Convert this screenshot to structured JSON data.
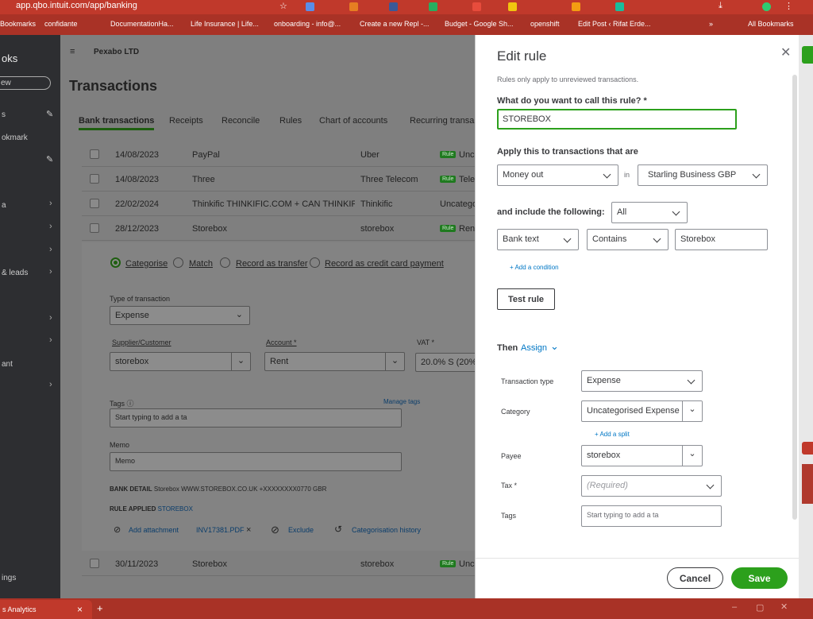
{
  "browser": {
    "url": "app.qbo.intuit.com/app/banking",
    "bookmarks": [
      "Bookmarks",
      "confidante",
      "DocumentationHa...",
      "Life Insurance | Life...",
      "onboarding - info@...",
      "Create a new Repl -...",
      "Budget - Google Sh...",
      "openshift",
      "Edit Post ‹ Rifat Erde..."
    ],
    "all_bookmarks": "All Bookmarks",
    "bottom_tab": "s Analytics"
  },
  "nav": {
    "items": [
      "oks",
      "ew",
      "s",
      "okmark",
      "a",
      "& leads",
      "ant",
      "ings"
    ]
  },
  "company": "Pexabo LTD",
  "page_title": "Transactions",
  "tabs": [
    "Bank transactions",
    "Receipts",
    "Reconcile",
    "Rules",
    "Chart of accounts",
    "Recurring transa"
  ],
  "rows": [
    {
      "date": "14/08/2023",
      "desc": "PayPal",
      "payee": "Uber",
      "cat": "Unca"
    },
    {
      "date": "14/08/2023",
      "desc": "Three",
      "payee": "Three Telecom",
      "cat": "Tele"
    },
    {
      "date": "22/02/2024",
      "desc": "Thinkific THINKIFIC.COM + CAN THINKIFIC.C",
      "payee": "Thinkific",
      "cat": "Uncategor"
    },
    {
      "date": "28/12/2023",
      "desc": "Storebox",
      "payee": "storebox",
      "cat": "Rent"
    }
  ],
  "last_row": {
    "date": "30/11/2023",
    "desc": "Storebox",
    "payee": "storebox",
    "cat": "Unca"
  },
  "rule_badge": "Rule",
  "expanded": {
    "radios": [
      "Categorise",
      "Match",
      "Record as transfer",
      "Record as credit card payment"
    ],
    "type_label": "Type of transaction",
    "type_value": "Expense",
    "supplier_label": "Supplier/Customer",
    "supplier_value": "storebox",
    "account_label": "Account *",
    "account_value": "Rent",
    "vat_label": "VAT *",
    "vat_value": "20.0% S (20%",
    "tags_label": "Tags ⓘ",
    "manage_tags": "Manage tags",
    "tags_placeholder": "Start typing to add a ta",
    "memo_label": "Memo",
    "memo_placeholder": "Memo",
    "bank_detail_label": "BANK DETAIL",
    "bank_detail_value": "Storebox WWW.STOREBOX.CO.UK +XXXXXXXX0770 GBR",
    "rule_applied_label": "RULE APPLIED",
    "rule_applied_value": "STOREBOX",
    "add_attachment": "Add attachment",
    "attachment_file": "INV17381.PDF",
    "exclude": "Exclude",
    "history": "Categorisation history"
  },
  "modal": {
    "title": "Edit rule",
    "note": "Rules only apply to unreviewed transactions.",
    "name_label": "What do you want to call this rule? *",
    "name_value": "STOREBOX",
    "apply_label": "Apply this to transactions that are",
    "money_dir": "Money out",
    "in": "in",
    "account": "Starling Business GBP",
    "include_label": "and include the following:",
    "include_value": "All",
    "cond_field": "Bank text",
    "cond_op": "Contains",
    "cond_value": "Storebox",
    "add_condition": "+ Add a condition",
    "test_rule": "Test rule",
    "then": "Then",
    "assign": "Assign",
    "tx_type_label": "Transaction type",
    "tx_type_value": "Expense",
    "category_label": "Category",
    "category_value": "Uncategorised Expense",
    "add_split": "+ Add a split",
    "payee_label": "Payee",
    "payee_value": "storebox",
    "tax_label": "Tax *",
    "tax_placeholder": "(Required)",
    "tags_label": "Tags",
    "tags_placeholder": "Start typing to add a ta",
    "cancel": "Cancel",
    "save": "Save"
  },
  "colors": {
    "green": "#2ca01c",
    "link": "#0077c5",
    "chrome": "#c0392b"
  }
}
